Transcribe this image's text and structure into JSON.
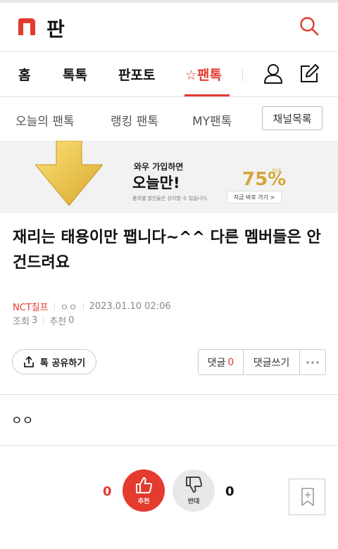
{
  "header": {
    "brand_title": "판",
    "logo_icon": "n-logo-icon",
    "search_icon": "search-icon",
    "accent_color": "#e33b2e"
  },
  "main_nav": {
    "items": [
      {
        "label": "홈"
      },
      {
        "label": "톡톡"
      },
      {
        "label": "판포토"
      },
      {
        "label": "☆팬톡",
        "active": true
      }
    ],
    "user_icon": "user-icon",
    "write_icon": "write-icon"
  },
  "sub_nav": {
    "items": [
      {
        "label": "오늘의 팬톡"
      },
      {
        "label": "랭킹 팬톡"
      },
      {
        "label": "MY팬톡"
      }
    ],
    "channel_button": "채널목록"
  },
  "banner": {
    "subtitle": "와우 가입하면",
    "title": "오늘만!",
    "note": "품목별 할인율은 상이할 수 있습니다.",
    "percent": "75%",
    "percent_label": "최대",
    "cta": "지금 바로 가기 >"
  },
  "post": {
    "title": "재리는 태용이만 팹니다~^^ 다른 멤버들은 안 건드려요",
    "author": "NCT칠프",
    "author_sub": "ㅇㅇ",
    "date": "2023.01.10 02:06",
    "views_label": "조회",
    "views": "3",
    "recommend_label": "추천",
    "recommend": "0",
    "body": "ㅇㅇ"
  },
  "actions": {
    "share_label": "톡 공유하기",
    "comment_label": "댓글",
    "comment_count": "0",
    "write_comment_label": "댓글쓰기",
    "more_icon": "more-icon"
  },
  "vote": {
    "up_count": "0",
    "up_label": "추천",
    "down_count": "0",
    "down_label": "반대"
  }
}
